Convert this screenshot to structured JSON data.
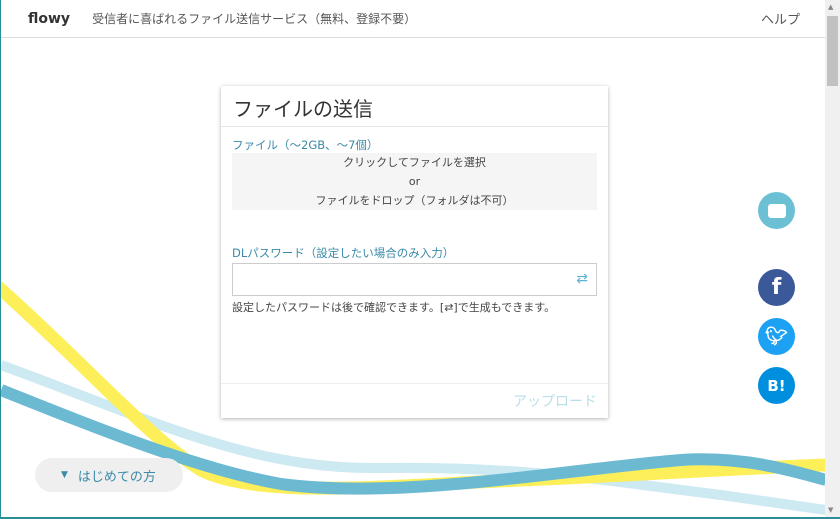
{
  "header": {
    "logo": "flowy",
    "tagline": "受信者に喜ばれるファイル送信サービス（無料、登録不要）",
    "help": "ヘルプ"
  },
  "card": {
    "title": "ファイルの送信",
    "file_label": "ファイル（～2GB、～7個）",
    "drop_line1": "クリックしてファイルを選択",
    "drop_or": "or",
    "drop_line2": "ファイルをドロップ（フォルダは不可）",
    "password_label": "DLパスワード（設定したい場合のみ入力）",
    "password_value": "",
    "password_hint": "設定したパスワードは後で確認できます。[⇄]で生成もできます。",
    "upload": "アップロード"
  },
  "social": {
    "facebook": "f",
    "hatena": "B!"
  },
  "first_time": "はじめての方",
  "colors": {
    "accent": "#3a8aa8",
    "facebook": "#3b5998",
    "twitter": "#1da1f2",
    "hatena": "#008fde",
    "chat": "#6cc0d4"
  }
}
